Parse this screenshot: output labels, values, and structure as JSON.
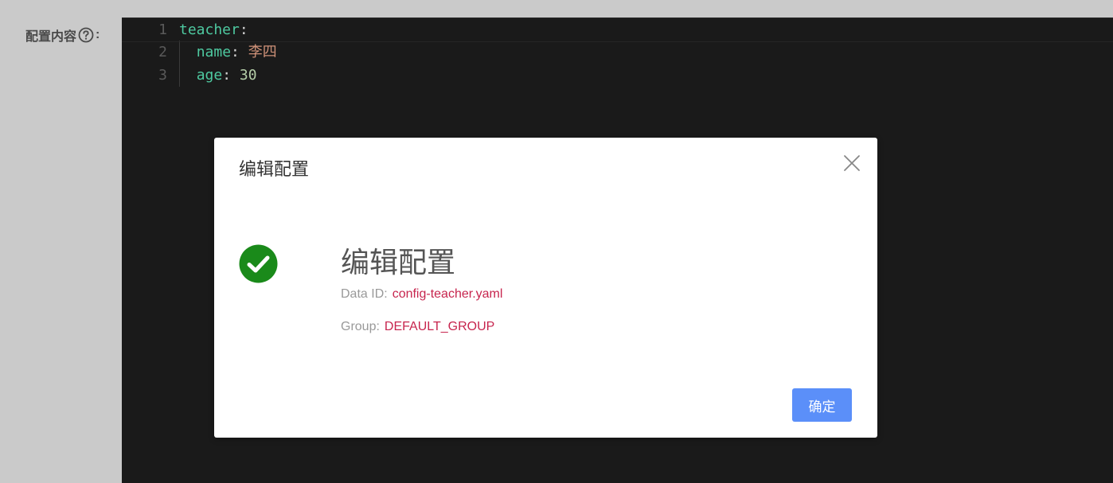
{
  "form": {
    "label": "配置内容",
    "colon": ":",
    "help_icon": "question-circle-icon"
  },
  "editor": {
    "lines": [
      {
        "num": "1",
        "key": "teacher",
        "sep": ":",
        "value": ""
      },
      {
        "num": "2",
        "key": "name",
        "sep": ": ",
        "value": "李四"
      },
      {
        "num": "3",
        "key": "age",
        "sep": ": ",
        "value": "30"
      }
    ]
  },
  "dialog": {
    "title": "编辑配置",
    "close_icon": "close-icon",
    "success_icon": "check-circle-icon",
    "message_title": "编辑配置",
    "data_id_label": "Data ID:",
    "data_id_value": "config-teacher.yaml",
    "group_label": "Group:",
    "group_value": "DEFAULT_GROUP",
    "ok_label": "确定"
  },
  "colors": {
    "accent": "#5b8ff9",
    "success": "#1a8a1a",
    "value_text": "#c7254e",
    "editor_bg": "#1a1a1a"
  }
}
